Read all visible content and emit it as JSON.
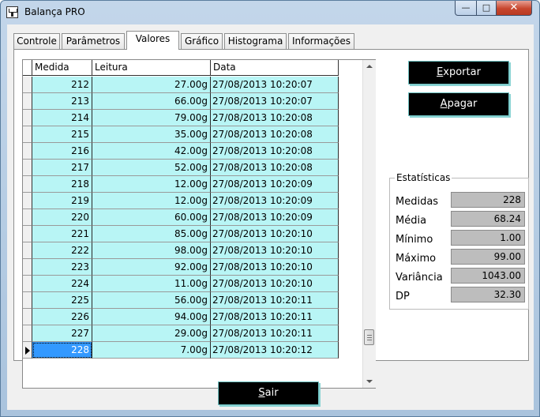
{
  "window": {
    "title": "Balança PRO",
    "min_label": "—",
    "max_label": "□",
    "close_label": "✕"
  },
  "tabs": [
    {
      "label": "Controle"
    },
    {
      "label": "Parâmetros"
    },
    {
      "label": "Valores"
    },
    {
      "label": "Gráfico"
    },
    {
      "label": "Histograma"
    },
    {
      "label": "Informações"
    }
  ],
  "active_tab": "Valores",
  "grid": {
    "columns": [
      "Medida",
      "Leitura",
      "Data"
    ],
    "selected_row": 228,
    "rows": [
      {
        "medida": "212",
        "leitura": "27.00g",
        "data": "27/08/2013 10:20:07"
      },
      {
        "medida": "213",
        "leitura": "66.00g",
        "data": "27/08/2013 10:20:07"
      },
      {
        "medida": "214",
        "leitura": "79.00g",
        "data": "27/08/2013 10:20:08"
      },
      {
        "medida": "215",
        "leitura": "35.00g",
        "data": "27/08/2013 10:20:08"
      },
      {
        "medida": "216",
        "leitura": "42.00g",
        "data": "27/08/2013 10:20:08"
      },
      {
        "medida": "217",
        "leitura": "52.00g",
        "data": "27/08/2013 10:20:08"
      },
      {
        "medida": "218",
        "leitura": "12.00g",
        "data": "27/08/2013 10:20:09"
      },
      {
        "medida": "219",
        "leitura": "12.00g",
        "data": "27/08/2013 10:20:09"
      },
      {
        "medida": "220",
        "leitura": "60.00g",
        "data": "27/08/2013 10:20:09"
      },
      {
        "medida": "221",
        "leitura": "85.00g",
        "data": "27/08/2013 10:20:10"
      },
      {
        "medida": "222",
        "leitura": "98.00g",
        "data": "27/08/2013 10:20:10"
      },
      {
        "medida": "223",
        "leitura": "92.00g",
        "data": "27/08/2013 10:20:10"
      },
      {
        "medida": "224",
        "leitura": "11.00g",
        "data": "27/08/2013 10:20:10"
      },
      {
        "medida": "225",
        "leitura": "56.00g",
        "data": "27/08/2013 10:20:11"
      },
      {
        "medida": "226",
        "leitura": "94.00g",
        "data": "27/08/2013 10:20:11"
      },
      {
        "medida": "227",
        "leitura": "29.00g",
        "data": "27/08/2013 10:20:11"
      },
      {
        "medida": "228",
        "leitura": "7.00g",
        "data": "27/08/2013 10:20:12"
      }
    ]
  },
  "buttons": {
    "exportar": {
      "mnemonic": "E",
      "rest": "xportar"
    },
    "apagar": {
      "mnemonic": "A",
      "rest": "pagar"
    },
    "sair": {
      "mnemonic": "S",
      "rest": "air"
    }
  },
  "stats": {
    "title": "Estatísticas",
    "items": [
      {
        "label": "Medidas",
        "value": "228"
      },
      {
        "label": "Média",
        "value": "68.24"
      },
      {
        "label": "Mínimo",
        "value": "1.00"
      },
      {
        "label": "Máximo",
        "value": "99.00"
      },
      {
        "label": "Variância",
        "value": "1043.00"
      },
      {
        "label": "DP",
        "value": "32.30"
      }
    ]
  },
  "colors": {
    "row_bg": "#b8f5f5",
    "selected": "#3399ff",
    "button_bg": "#000000",
    "button_border": "#6fc3c3"
  }
}
